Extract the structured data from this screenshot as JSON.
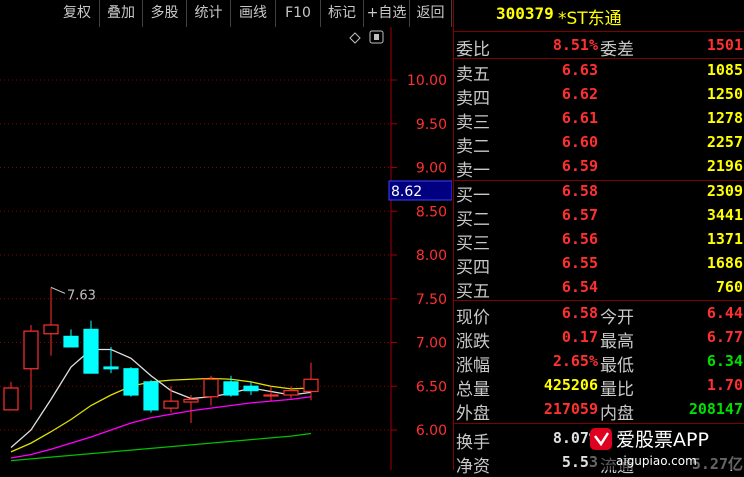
{
  "toolbar": {
    "buttons": [
      "复权",
      "叠加",
      "多股",
      "统计",
      "画线",
      "F10",
      "标记",
      "+自选",
      "返回"
    ]
  },
  "stock": {
    "code": "300379",
    "name": "*ST东通"
  },
  "order_book": {
    "ratio_label": "委比",
    "ratio_value": "8.51%",
    "diff_label": "委差",
    "diff_value": "1501",
    "asks": [
      {
        "label": "卖五",
        "price": "6.63",
        "volume": "1085"
      },
      {
        "label": "卖四",
        "price": "6.62",
        "volume": "1250"
      },
      {
        "label": "卖三",
        "price": "6.61",
        "volume": "1278"
      },
      {
        "label": "卖二",
        "price": "6.60",
        "volume": "2257"
      },
      {
        "label": "卖一",
        "price": "6.59",
        "volume": "2196"
      }
    ],
    "bids": [
      {
        "label": "买一",
        "price": "6.58",
        "volume": "2309"
      },
      {
        "label": "买二",
        "price": "6.57",
        "volume": "3441"
      },
      {
        "label": "买三",
        "price": "6.56",
        "volume": "1371"
      },
      {
        "label": "买四",
        "price": "6.55",
        "volume": "1686"
      },
      {
        "label": "买五",
        "price": "6.54",
        "volume": "760"
      }
    ]
  },
  "quote": [
    {
      "l1": "现价",
      "v1": "6.58",
      "c1": "red",
      "l2": "今开",
      "v2": "6.44",
      "c2": "red"
    },
    {
      "l1": "涨跌",
      "v1": "0.17",
      "c1": "red",
      "l2": "最高",
      "v2": "6.77",
      "c2": "red"
    },
    {
      "l1": "涨幅",
      "v1": "2.65%",
      "c1": "red",
      "l2": "最低",
      "v2": "6.34",
      "c2": "green"
    },
    {
      "l1": "总量",
      "v1": "425206",
      "c1": "yellow",
      "l2": "量比",
      "v2": "1.70",
      "c2": "red"
    },
    {
      "l1": "外盘",
      "v1": "217059",
      "c1": "red",
      "l2": "内盘",
      "v2": "208147",
      "c2": "green"
    },
    {
      "l1": "换手",
      "v1": "8.07%",
      "c1": "white",
      "l2": "",
      "v2": "",
      "c2": "white"
    },
    {
      "l1": "净资",
      "v1": "5.53",
      "c1": "white",
      "l2": "流通",
      "v2": "5.27亿",
      "c2": "white"
    }
  ],
  "chart_data": {
    "type": "candlestick",
    "y_ticks": [
      "10.00",
      "9.50",
      "9.00",
      "8.50",
      "8.00",
      "7.50",
      "7.00",
      "6.50",
      "6.00"
    ],
    "ylim": [
      5.65,
      10.3
    ],
    "crosshair_price": "8.62",
    "high_label": "7.63",
    "candles": [
      {
        "o": 6.23,
        "h": 6.55,
        "l": 6.23,
        "c": 6.48
      },
      {
        "o": 6.7,
        "h": 7.2,
        "l": 6.23,
        "c": 7.13
      },
      {
        "o": 7.1,
        "h": 7.63,
        "l": 6.85,
        "c": 7.2
      },
      {
        "o": 7.07,
        "h": 7.15,
        "l": 6.95,
        "c": 6.95
      },
      {
        "o": 7.15,
        "h": 7.25,
        "l": 6.65,
        "c": 6.65
      },
      {
        "o": 6.72,
        "h": 6.95,
        "l": 6.65,
        "c": 6.7
      },
      {
        "o": 6.7,
        "h": 6.72,
        "l": 6.38,
        "c": 6.4
      },
      {
        "o": 6.55,
        "h": 6.57,
        "l": 6.2,
        "c": 6.23
      },
      {
        "o": 6.25,
        "h": 6.5,
        "l": 6.2,
        "c": 6.33
      },
      {
        "o": 6.32,
        "h": 6.4,
        "l": 6.08,
        "c": 6.35
      },
      {
        "o": 6.38,
        "h": 6.62,
        "l": 6.28,
        "c": 6.58
      },
      {
        "o": 6.55,
        "h": 6.62,
        "l": 6.38,
        "c": 6.4
      },
      {
        "o": 6.5,
        "h": 6.55,
        "l": 6.4,
        "c": 6.45
      },
      {
        "o": 6.4,
        "h": 6.5,
        "l": 6.33,
        "c": 6.4
      },
      {
        "o": 6.4,
        "h": 6.5,
        "l": 6.36,
        "c": 6.45
      },
      {
        "o": 6.44,
        "h": 6.77,
        "l": 6.34,
        "c": 6.58
      }
    ],
    "ma_white": [
      5.8,
      6.0,
      6.35,
      6.72,
      6.92,
      6.92,
      6.82,
      6.62,
      6.45,
      6.36,
      6.38,
      6.42,
      6.48,
      6.44,
      6.4,
      6.43
    ],
    "ma_yellow": [
      5.75,
      5.85,
      5.98,
      6.12,
      6.28,
      6.4,
      6.5,
      6.55,
      6.57,
      6.58,
      6.59,
      6.58,
      6.55,
      6.5,
      6.47,
      6.48
    ],
    "ma_magenta": [
      5.68,
      5.72,
      5.78,
      5.85,
      5.92,
      6.0,
      6.08,
      6.14,
      6.18,
      6.22,
      6.25,
      6.28,
      6.31,
      6.33,
      6.35,
      6.38
    ],
    "ma_green": [
      5.65,
      5.67,
      5.69,
      5.71,
      5.73,
      5.75,
      5.77,
      5.79,
      5.81,
      5.83,
      5.85,
      5.87,
      5.89,
      5.91,
      5.93,
      5.96
    ]
  },
  "watermark": {
    "text": "爱股票APP",
    "url": "aigupiao.com"
  }
}
